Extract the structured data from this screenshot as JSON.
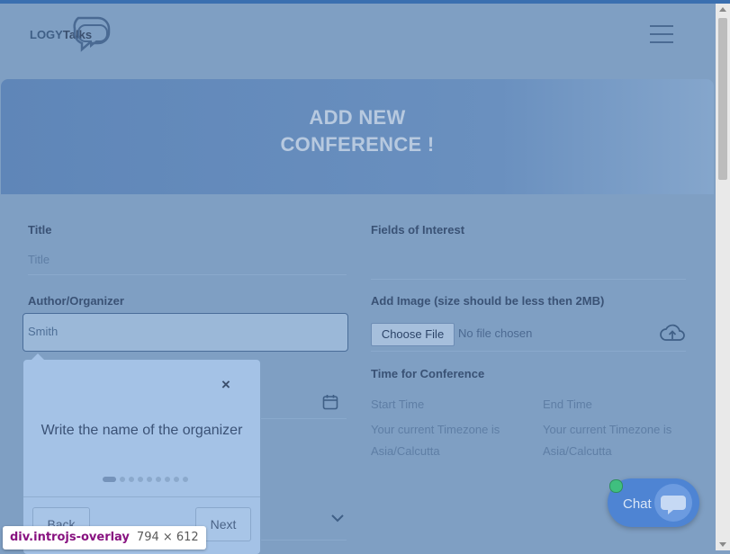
{
  "brand": {
    "logo_text_part1": "LOGY",
    "logo_text_part2": "Talks"
  },
  "hero": {
    "title_line1": "ADD NEW",
    "title_line2": "CONFERENCE !"
  },
  "form": {
    "title_label": "Title",
    "title_placeholder": "Title",
    "fields_of_interest_label": "Fields of Interest",
    "author_label": "Author/Organizer",
    "author_value": "Smith",
    "add_image_label": "Add Image (size should be less then 2MB)",
    "choose_file_label": "Choose File",
    "file_status": "No file chosen",
    "time_label": "Time for Conference",
    "start_time_label": "Start Time",
    "end_time_label": "End Time",
    "start_timezone_note": "Your current Timezone is Asia/Calcutta",
    "end_timezone_note": "Your current Timezone is Asia/Calcutta"
  },
  "tour": {
    "close_symbol": "×",
    "message": "Write the name of the organizer",
    "step_count": 9,
    "active_step": 1,
    "back_label": "Back",
    "next_label": "Next"
  },
  "chat": {
    "label": "Chat"
  },
  "inspector": {
    "selector": "div.introjs-overlay",
    "dimensions": "794 × 612"
  },
  "colors": {
    "overlay_tint": "#7f9fc3",
    "chat_button": "#4e84d3",
    "online_dot": "#3fbf7f"
  }
}
